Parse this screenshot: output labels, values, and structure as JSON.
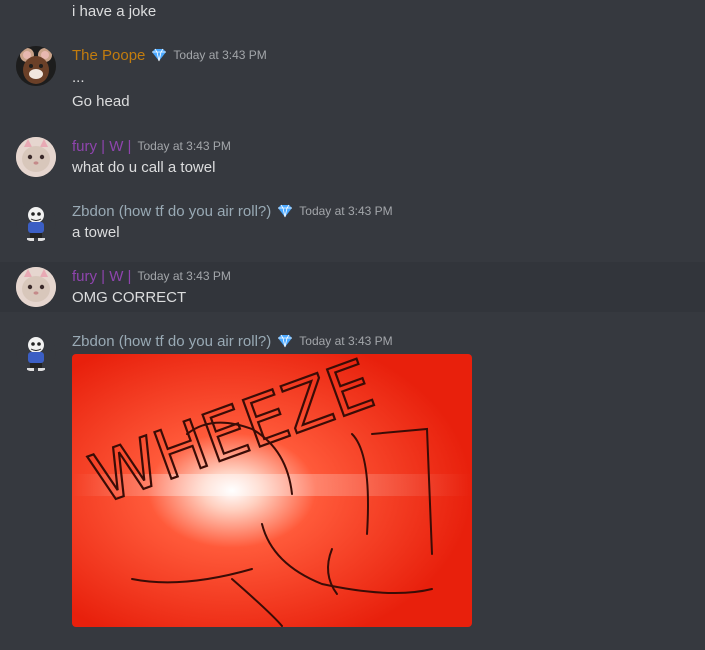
{
  "messages": [
    {
      "continuation_text": "i have a joke"
    },
    {
      "author": "The Poope",
      "author_color": "#c27c0e",
      "badge": "diamond-icon",
      "timestamp": "Today at 3:43 PM",
      "lines": [
        "...",
        "Go head"
      ]
    },
    {
      "author": "fury | W |",
      "author_color": "#8e44ad",
      "timestamp": "Today at 3:43 PM",
      "lines": [
        "what do u call a towel"
      ]
    },
    {
      "author": "Zbdon (how tf do you air roll?)",
      "author_color": "#99aab5",
      "badge": "diamond-icon",
      "timestamp": "Today at 3:43 PM",
      "lines": [
        "a towel"
      ]
    },
    {
      "author": "fury | W |",
      "author_color": "#8e44ad",
      "timestamp": "Today at 3:43 PM",
      "lines": [
        "OMG CORRECT"
      ]
    },
    {
      "author": "Zbdon (how tf do you air roll?)",
      "author_color": "#99aab5",
      "badge": "diamond-icon",
      "timestamp": "Today at 3:43 PM",
      "attachment_text": "WHEEZE"
    }
  ],
  "colors": {
    "background": "#36393f",
    "hover": "#32353b",
    "text": "#dcddde",
    "timestamp": "#a3a6aa",
    "badge": "#4aa8ff",
    "attachment_red": "#f02a10"
  }
}
